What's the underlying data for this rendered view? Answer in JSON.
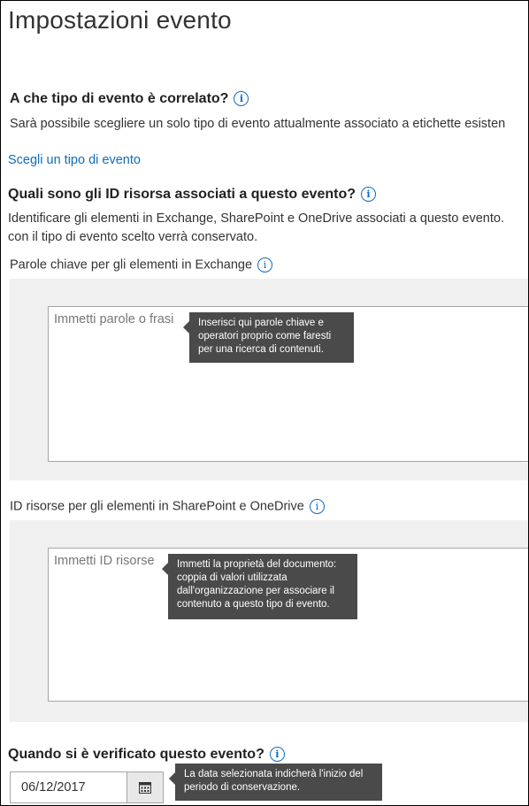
{
  "page": {
    "title": "Impostazioni evento"
  },
  "event_type": {
    "heading": "A che tipo di evento è correlato?",
    "description": "Sarà possibile scegliere un solo tipo di evento attualmente associato a etichette esisten",
    "link": "Scegli un tipo di evento"
  },
  "asset_ids": {
    "heading": "Quali sono gli ID risorsa associati a questo evento?",
    "description_line1": "Identificare gli elementi in Exchange, SharePoint e OneDrive associati a questo evento.",
    "description_line2": "con il tipo di evento scelto verrà conservato."
  },
  "exchange_keywords": {
    "label": "Parole chiave per gli elementi in Exchange",
    "placeholder": "Immetti parole o frasi",
    "tooltip_lines": [
      "Inserisci qui parole chiave e",
      "operatori proprio come faresti",
      "per una ricerca di contenuti."
    ]
  },
  "sharepoint_ids": {
    "label": "ID risorse per gli elementi in SharePoint e OneDrive",
    "placeholder": "Immetti ID risorse",
    "tooltip_lines": [
      "Immetti la proprietà del documento:",
      "coppia di valori utilizzata",
      "dall'organizzazione per associare il",
      "contenuto a questo tipo di evento."
    ]
  },
  "event_date": {
    "heading": "Quando si è verificato questo evento?",
    "value": "06/12/2017",
    "tooltip_lines": [
      "La data selezionata indicherà l'inizio del",
      "periodo di conservazione."
    ]
  },
  "icons": {
    "info": "info-icon",
    "calendar": "calendar-icon"
  },
  "colors": {
    "link": "#0f6cbd",
    "tooltip_bg": "#4a4a4a",
    "box_bg": "#f0f0f0"
  }
}
